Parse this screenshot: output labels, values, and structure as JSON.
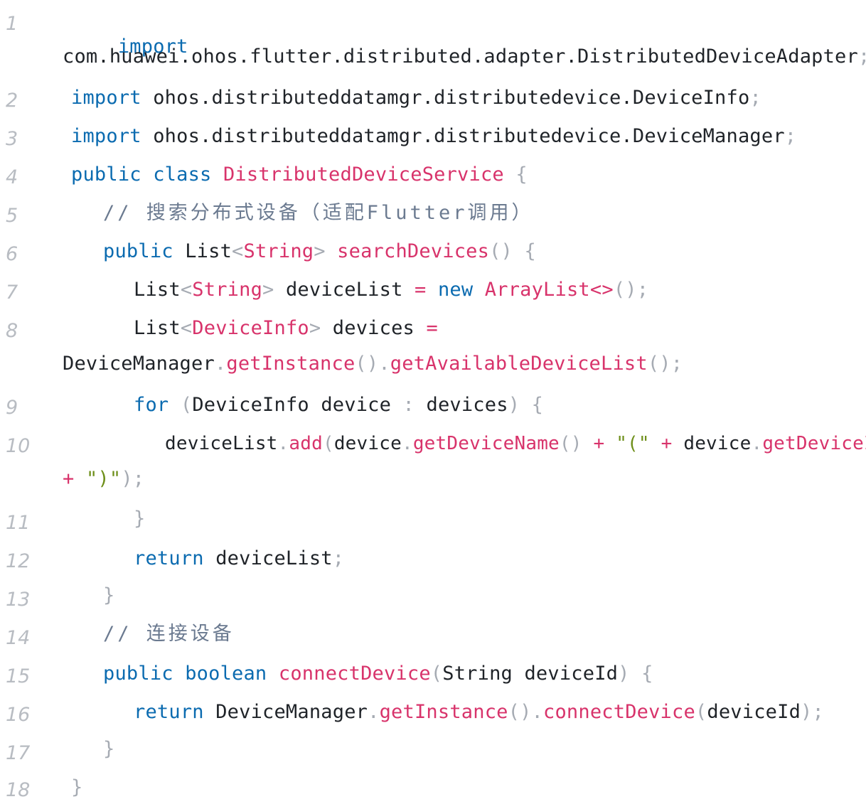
{
  "line_numbers": [
    "1",
    "2",
    "3",
    "4",
    "5",
    "6",
    "7",
    "8",
    "9",
    "10",
    "11",
    "12",
    "13",
    "14",
    "15",
    "16",
    "17",
    "18"
  ],
  "code": {
    "l1": {
      "kw": "import",
      "wrap": "com.huawei.ohos.flutter.distributed.adapter.DistributedDeviceAdapter",
      "semi": ";"
    },
    "l2": {
      "kw": "import",
      "path": "ohos.distributeddatamgr.distributedevice.DeviceInfo",
      "semi": ";"
    },
    "l3": {
      "kw": "import",
      "path": "ohos.distributeddatamgr.distributedevice.DeviceManager",
      "semi": ";"
    },
    "l4": {
      "kw1": "public",
      "kw2": "class",
      "cls": "DistributedDeviceService",
      "brace": "{"
    },
    "l5": {
      "comment": "// 搜索分布式设备（适配Flutter调用）"
    },
    "l6": {
      "kw": "public",
      "type": "List",
      "lt": "<",
      "generic": "String",
      "gt": ">",
      "fn": "searchDevices",
      "parens": "()",
      "brace": "{"
    },
    "l7": {
      "type": "List",
      "lt": "<",
      "generic": "String",
      "gt": ">",
      "var": "deviceList",
      "eq": "=",
      "kw": "new",
      "cls": "ArrayList",
      "diamond": "<>",
      "end": "();"
    },
    "l8": {
      "type": "List",
      "lt": "<",
      "generic": "DeviceInfo",
      "gt": ">",
      "var": "devices",
      "eq": "=",
      "wrap_obj": "DeviceManager",
      "dot1": ".",
      "fn1": "getInstance",
      "p1": "()",
      "dot2": ".",
      "fn2": "getAvailableDeviceList",
      "end": "();"
    },
    "l9": {
      "kw": "for",
      "open": "(",
      "type": "DeviceInfo",
      "var": "device",
      "colon": ":",
      "coll": "devices",
      "close": ")",
      "brace": "{"
    },
    "l10": {
      "obj": "deviceList",
      "dot": ".",
      "fn": "add",
      "open": "(",
      "arg1": "device",
      "dot2": ".",
      "fn2": "getDeviceName",
      "p2": "()",
      "plus1": "+",
      "str1": "\"(\"",
      "plus2": "+",
      "arg2": "device",
      "dot3": ".",
      "fn3": "getDeviceId",
      "p3": "()",
      "wrap_plus": "+",
      "wrap_str": "\")\"",
      "wrap_end": ");"
    },
    "l11": {
      "brace": "}"
    },
    "l12": {
      "kw": "return",
      "var": "deviceList",
      "semi": ";"
    },
    "l13": {
      "brace": "}"
    },
    "l14": {
      "comment": "// 连接设备"
    },
    "l15": {
      "kw1": "public",
      "kw2": "boolean",
      "fn": "connectDevice",
      "open": "(",
      "type": "String",
      "param": "deviceId",
      "close": ")",
      "brace": "{"
    },
    "l16": {
      "kw": "return",
      "obj": "DeviceManager",
      "dot1": ".",
      "fn1": "getInstance",
      "p1": "()",
      "dot2": ".",
      "fn2": "connectDevice",
      "open": "(",
      "arg": "deviceId",
      "end": ");"
    },
    "l17": {
      "brace": "}"
    },
    "l18": {
      "brace": "}"
    }
  }
}
